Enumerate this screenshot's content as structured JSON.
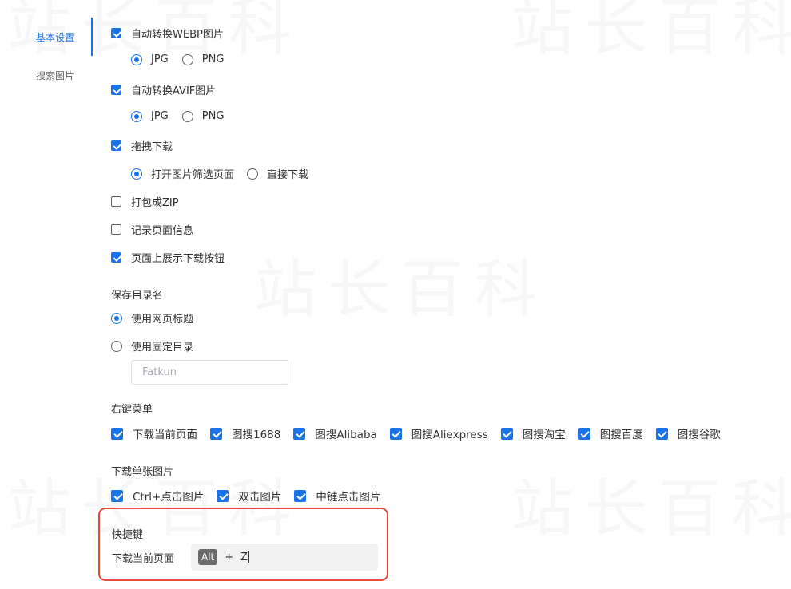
{
  "watermark": "站长百科",
  "sidebar": {
    "items": [
      {
        "label": "基本设置",
        "active": true
      },
      {
        "label": "搜索图片",
        "active": false
      }
    ]
  },
  "settings": {
    "webp": {
      "label": "自动转换WEBP图片",
      "checked": true,
      "formats": [
        "JPG",
        "PNG"
      ],
      "selected": "JPG"
    },
    "avif": {
      "label": "自动转换AVIF图片",
      "checked": true,
      "formats": [
        "JPG",
        "PNG"
      ],
      "selected": "JPG"
    },
    "drag": {
      "label": "拖拽下载",
      "checked": true,
      "options": [
        "打开图片筛选页面",
        "直接下载"
      ],
      "selected": "打开图片筛选页面"
    },
    "zip": {
      "label": "打包成ZIP",
      "checked": false
    },
    "record": {
      "label": "记录页面信息",
      "checked": false
    },
    "show_button": {
      "label": "页面上展示下载按钮",
      "checked": true
    }
  },
  "save_dir": {
    "title": "保存目录名",
    "options": [
      "使用网页标题",
      "使用固定目录"
    ],
    "selected": "使用网页标题",
    "fixed_value": "",
    "fixed_placeholder": "Fatkun"
  },
  "context_menu": {
    "title": "右键菜单",
    "items": [
      {
        "label": "下载当前页面",
        "checked": true
      },
      {
        "label": "图搜1688",
        "checked": true
      },
      {
        "label": "图搜Alibaba",
        "checked": true
      },
      {
        "label": "图搜Aliexpress",
        "checked": true
      },
      {
        "label": "图搜淘宝",
        "checked": true
      },
      {
        "label": "图搜百度",
        "checked": true
      },
      {
        "label": "图搜谷歌",
        "checked": true
      }
    ]
  },
  "single_download": {
    "title": "下载单张图片",
    "items": [
      {
        "label": "Ctrl+点击图片",
        "checked": true
      },
      {
        "label": "双击图片",
        "checked": true
      },
      {
        "label": "中键点击图片",
        "checked": true
      }
    ]
  },
  "shortcut": {
    "title": "快捷键",
    "label": "下载当前页面",
    "modifier": "Alt",
    "plus": "+",
    "key": "Z"
  },
  "colors": {
    "accent": "#1a73e8",
    "highlight_border": "#e84a3b"
  }
}
